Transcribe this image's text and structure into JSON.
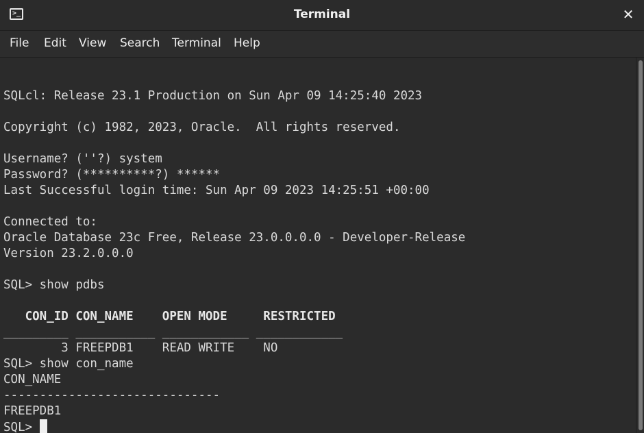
{
  "window": {
    "title": "Terminal",
    "close_glyph": "✕",
    "icon": "terminal-icon"
  },
  "menu": {
    "items": [
      "File",
      "Edit",
      "View",
      "Search",
      "Terminal",
      "Help"
    ]
  },
  "terminal": {
    "lines": [
      "SQLcl: Release 23.1 Production on Sun Apr 09 14:25:40 2023",
      "",
      "Copyright (c) 1982, 2023, Oracle.  All rights reserved.",
      "",
      "Username? (''?) system",
      "Password? (**********?) ******",
      "Last Successful login time: Sun Apr 09 2023 14:25:51 +00:00",
      "",
      "Connected to:",
      "Oracle Database 23c Free, Release 23.0.0.0.0 - Developer-Release",
      "Version 23.2.0.0.0",
      "",
      "SQL> show pdbs",
      "",
      "   CON_ID CON_NAME    OPEN MODE     RESTRICTED",
      "_________ ___________ ____________ ____________",
      "        3 FREEPDB1    READ WRITE    NO",
      "SQL> show con_name",
      "CON_NAME",
      "------------------------------",
      "FREEPDB1",
      "SQL> "
    ]
  },
  "colors": {
    "background": "#2b2b2b",
    "text": "#d9d9d9",
    "cursor": "#f0f0f0"
  }
}
